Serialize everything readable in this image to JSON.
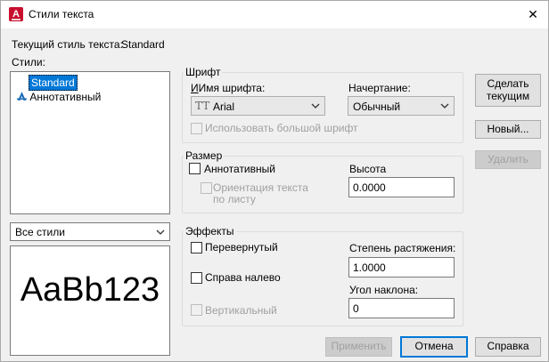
{
  "window": {
    "title": "Стили текста",
    "close_glyph": "✕"
  },
  "current_style": {
    "label": "Текущий стиль текста:",
    "value": "Standard"
  },
  "styles": {
    "label": "Стили:",
    "items": [
      {
        "label": "Standard",
        "selected": true
      },
      {
        "label": "Аннотативный",
        "icon": "annotative-icon"
      }
    ],
    "filter_value": "Все стили"
  },
  "preview": {
    "text": "AaBb123"
  },
  "font": {
    "group_title": "Шрифт",
    "name_label": "Имя шрифта:",
    "name_value": "Arial",
    "style_label": "Начертание:",
    "style_value": "Обычный",
    "bigfont_label": "Использовать большой шрифт"
  },
  "size": {
    "group_title": "Размер",
    "annotative_label": "Аннотативный",
    "orientation_label_line1": "Ориентация текста",
    "orientation_label_line2": "по листу",
    "height_label": "Высота",
    "height_value": "0.0000"
  },
  "effects": {
    "group_title": "Эффекты",
    "upside_down_label": "Перевернутый",
    "backwards_label": "Справа налево",
    "vertical_label": "Вертикальный",
    "width_factor_label": "Степень растяжения:",
    "width_factor_value": "1.0000",
    "oblique_label": "Угол наклона:",
    "oblique_value": "0"
  },
  "buttons": {
    "set_current_line1": "Сделать",
    "set_current_line2": "текущим",
    "new": "Новый...",
    "delete": "Удалить",
    "apply": "Применить",
    "cancel": "Отмена",
    "help": "Справка"
  },
  "colors": {
    "accent": "#0078d7",
    "selection": "#0078d7",
    "brand": "#c8102e"
  }
}
